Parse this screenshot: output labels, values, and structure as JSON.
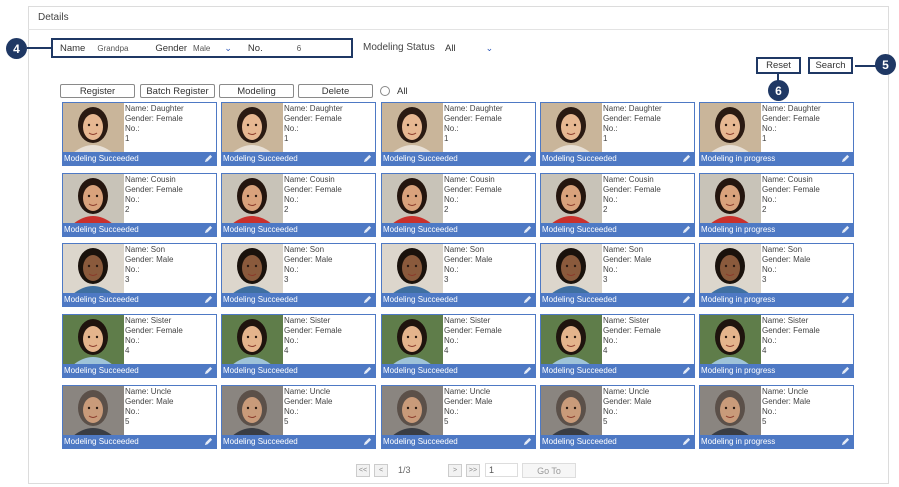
{
  "header": {
    "title": "Details"
  },
  "filters": {
    "name_label": "Name",
    "name_value": "Grandpa",
    "gender_label": "Gender",
    "gender_value": "Male",
    "no_label": "No.",
    "no_value": "6",
    "status_label": "Modeling Status",
    "status_value": "All"
  },
  "callouts": {
    "c4": "4",
    "c5": "5",
    "c6": "6"
  },
  "buttons": {
    "reset": "Reset",
    "search": "Search"
  },
  "actions": {
    "register": "Register",
    "batch_register": "Batch Register",
    "modeling": "Modeling",
    "delete": "Delete",
    "all_label": "All"
  },
  "people": [
    {
      "name": "Name: Daughter",
      "gender": "Gender: Female",
      "no_label": "No.:",
      "no": "1"
    },
    {
      "name": "Name: Cousin",
      "gender": "Gender: Female",
      "no_label": "No.:",
      "no": "2"
    },
    {
      "name": "Name: Son",
      "gender": "Gender: Male",
      "no_label": "No.:",
      "no": "3"
    },
    {
      "name": "Name: Sister",
      "gender": "Gender: Female",
      "no_label": "No.:",
      "no": "4"
    },
    {
      "name": "Name: Uncle",
      "gender": "Gender: Male",
      "no_label": "No.:",
      "no": "5"
    }
  ],
  "columns": [
    {
      "status": "Modeling Succeeded"
    },
    {
      "status": "Modeling Succeeded"
    },
    {
      "status": "Modeling Succeeded"
    },
    {
      "status": "Modeling Succeeded"
    },
    {
      "status": "Modeling in progress"
    }
  ],
  "pagination": {
    "first": "<<",
    "prev": "<",
    "page_info": "1/3",
    "next": ">",
    "last": ">>",
    "page_input": "1",
    "goto": "Go To"
  },
  "colors": {
    "accent": "#4e79c4",
    "callout": "#1f3864"
  }
}
